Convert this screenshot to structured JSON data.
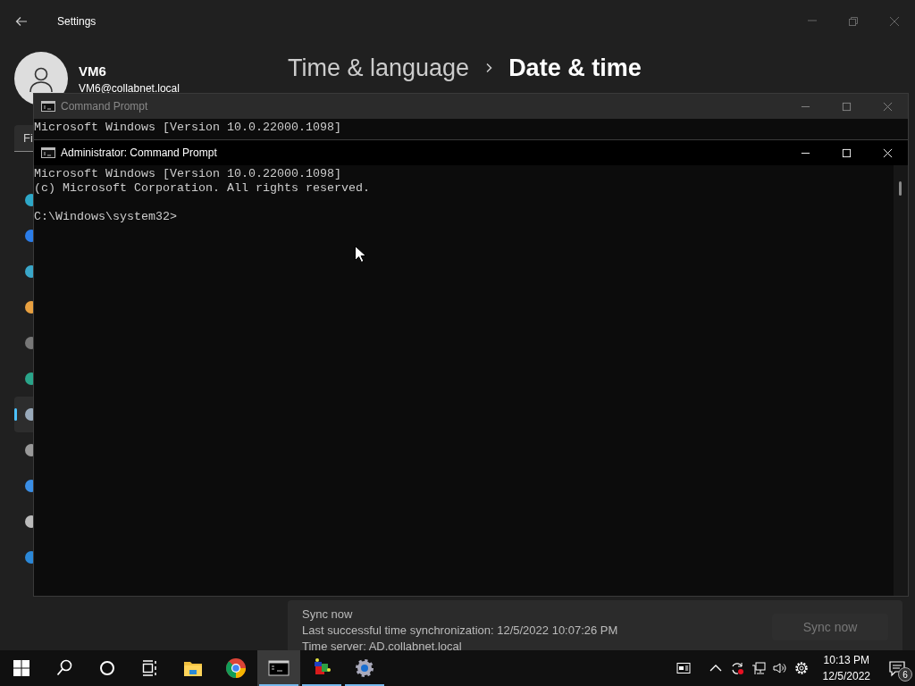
{
  "settings": {
    "title": "Settings",
    "profile": {
      "name": "VM6",
      "email": "VM6@collabnet.local"
    },
    "search": {
      "placeholder": "Fi"
    },
    "nav": [
      {
        "selected": false
      },
      {
        "selected": false
      },
      {
        "selected": false
      },
      {
        "selected": false
      },
      {
        "selected": false
      },
      {
        "selected": false
      },
      {
        "selected": true
      },
      {
        "selected": false
      },
      {
        "selected": false
      },
      {
        "selected": false
      },
      {
        "selected": false
      }
    ],
    "breadcrumb": [
      {
        "label": "Time & language",
        "current": false
      },
      {
        "label": "Date & time",
        "current": true
      }
    ],
    "sync": {
      "title": "Sync now",
      "last_sync": "Last successful time synchronization: 12/5/2022 10:07:26 PM",
      "server": "Time server: AD.collabnet.local",
      "button": {
        "label": "Sync now",
        "disabled": true
      }
    }
  },
  "windows": [
    {
      "title": "Command Prompt",
      "active": false,
      "lines": [
        "Microsoft Windows [Version 10.0.22000.1098]"
      ]
    },
    {
      "title": "Administrator: Command Prompt",
      "active": true,
      "lines": [
        "Microsoft Windows [Version 10.0.22000.1098]",
        "(c) Microsoft Corporation. All rights reserved."
      ],
      "prompt": "C:\\Windows\\system32>"
    }
  ],
  "taskbar": {
    "apps": [
      {
        "kind": "start",
        "active": false,
        "open": false
      },
      {
        "kind": "search",
        "active": false,
        "open": false
      },
      {
        "kind": "cortana",
        "active": false,
        "open": false
      },
      {
        "kind": "taskview",
        "active": false,
        "open": false
      },
      {
        "kind": "explorer",
        "active": false,
        "open": false
      },
      {
        "kind": "chrome",
        "active": false,
        "open": false
      },
      {
        "kind": "terminal",
        "active": true,
        "open": true
      },
      {
        "kind": "blocks",
        "active": false,
        "open": true
      },
      {
        "kind": "gear",
        "active": false,
        "open": true
      }
    ],
    "tray": [
      {
        "kind": "widgets"
      },
      {
        "kind": "chevron"
      },
      {
        "kind": "sync"
      },
      {
        "kind": "network"
      },
      {
        "kind": "volume"
      },
      {
        "kind": "gear"
      }
    ],
    "time": "10:13 PM",
    "date": "12/5/2022",
    "notifications": "6"
  }
}
